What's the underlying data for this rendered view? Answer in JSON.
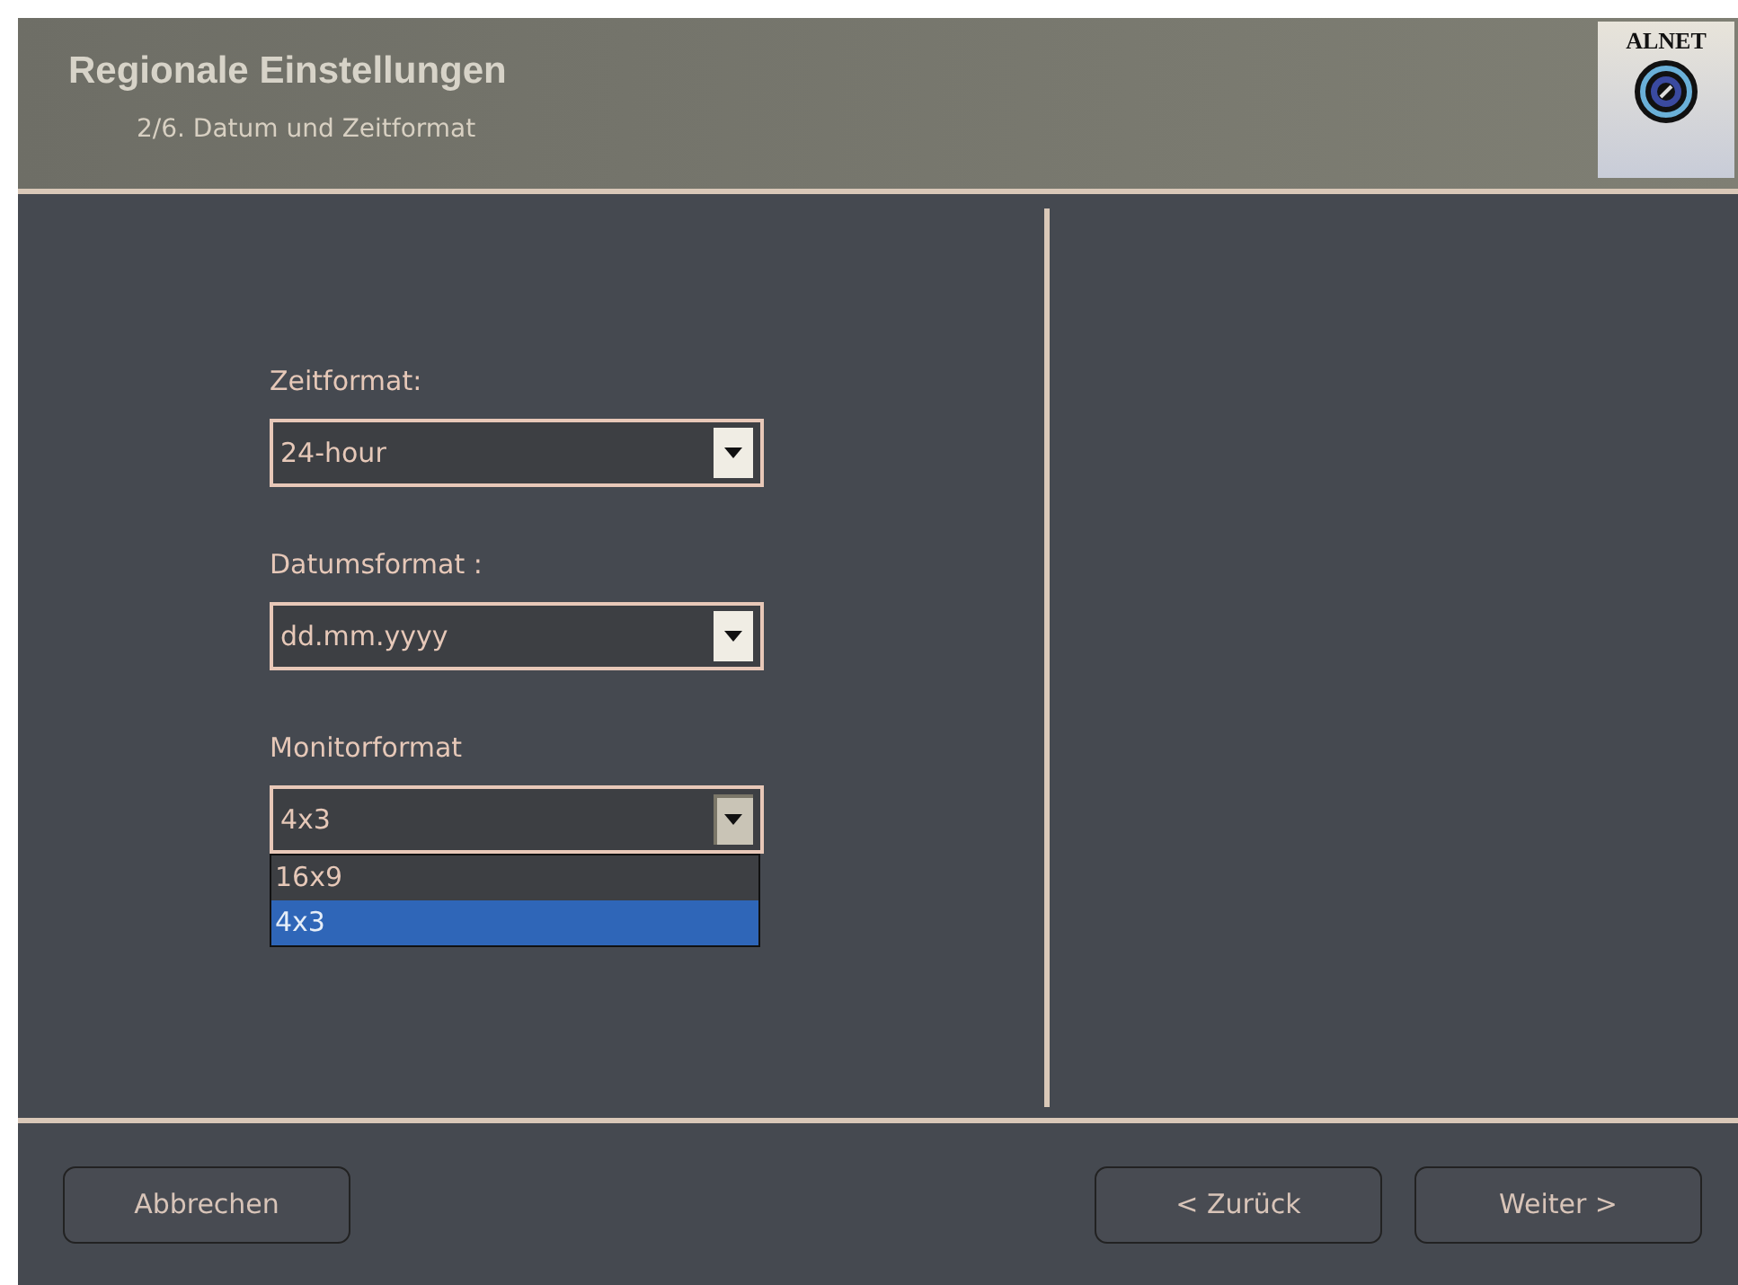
{
  "header": {
    "title": "Regionale Einstellungen",
    "subtitle": "2/6. Datum und Zeitformat",
    "logo_text": "ALNET"
  },
  "fields": [
    {
      "label": "Zeitformat:",
      "value": "24-hour",
      "expanded": false
    },
    {
      "label": "Datumsformat :",
      "value": "dd.mm.yyyy",
      "expanded": false
    },
    {
      "label": "Monitorformat",
      "value": "4x3",
      "expanded": true,
      "options": [
        {
          "label": "16x9",
          "selected": false
        },
        {
          "label": "4x3",
          "selected": true
        }
      ]
    }
  ],
  "buttons": {
    "left": [
      "Abbrechen"
    ],
    "right": [
      "< Zurück",
      "Weiter >"
    ]
  }
}
